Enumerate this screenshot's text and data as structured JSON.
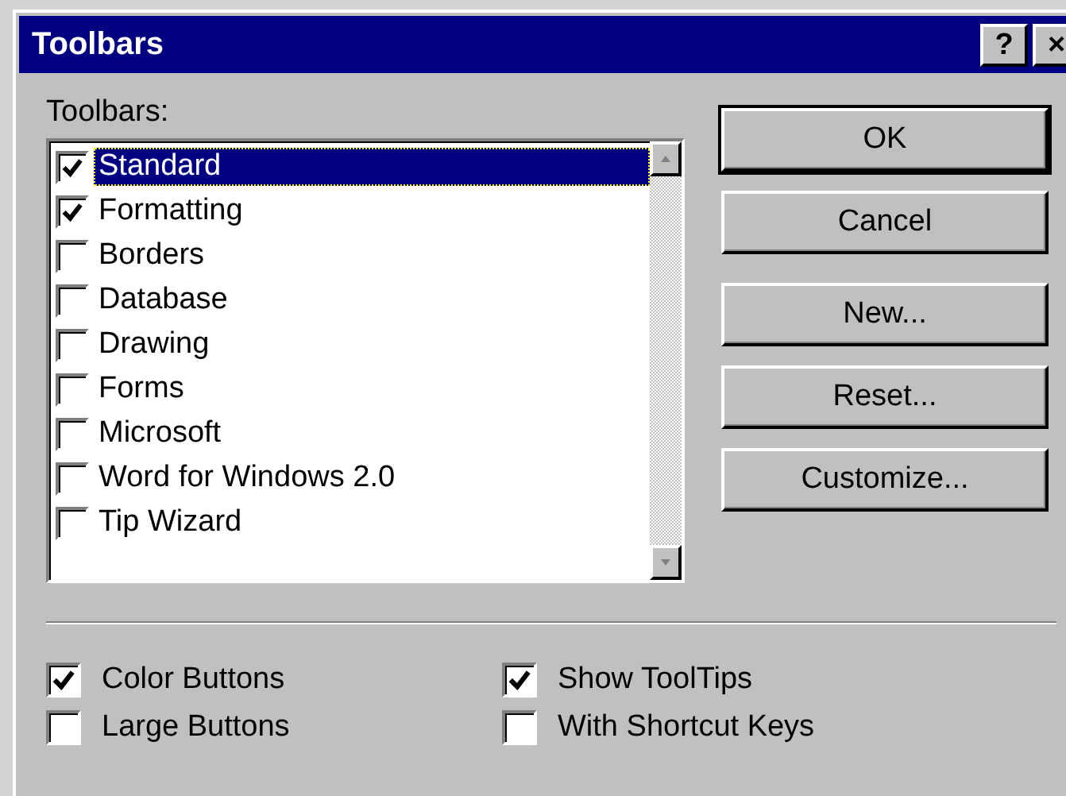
{
  "window": {
    "title": "Toolbars",
    "title_buttons": [
      "?",
      "×"
    ]
  },
  "toolbars": {
    "label": "Toolbars:",
    "items": [
      {
        "label": "Standard",
        "checked": true,
        "selected": true
      },
      {
        "label": "Formatting",
        "checked": true,
        "selected": false
      },
      {
        "label": "Borders",
        "checked": false,
        "selected": false
      },
      {
        "label": "Database",
        "checked": false,
        "selected": false
      },
      {
        "label": "Drawing",
        "checked": false,
        "selected": false
      },
      {
        "label": "Forms",
        "checked": false,
        "selected": false
      },
      {
        "label": "Microsoft",
        "checked": false,
        "selected": false
      },
      {
        "label": "Word for Windows 2.0",
        "checked": false,
        "selected": false
      },
      {
        "label": "Tip Wizard",
        "checked": false,
        "selected": false
      }
    ]
  },
  "buttons": [
    {
      "label": "OK",
      "default": true
    },
    {
      "label": "Cancel",
      "default": false
    },
    {
      "label": "New...",
      "default": false
    },
    {
      "label": "Reset...",
      "default": false
    },
    {
      "label": "Customize...",
      "default": false
    }
  ],
  "options": [
    {
      "label": "Color Buttons",
      "checked": true
    },
    {
      "label": "Show ToolTips",
      "checked": true
    },
    {
      "label": "Large Buttons",
      "checked": false
    },
    {
      "label": "With Shortcut Keys",
      "checked": false
    }
  ]
}
